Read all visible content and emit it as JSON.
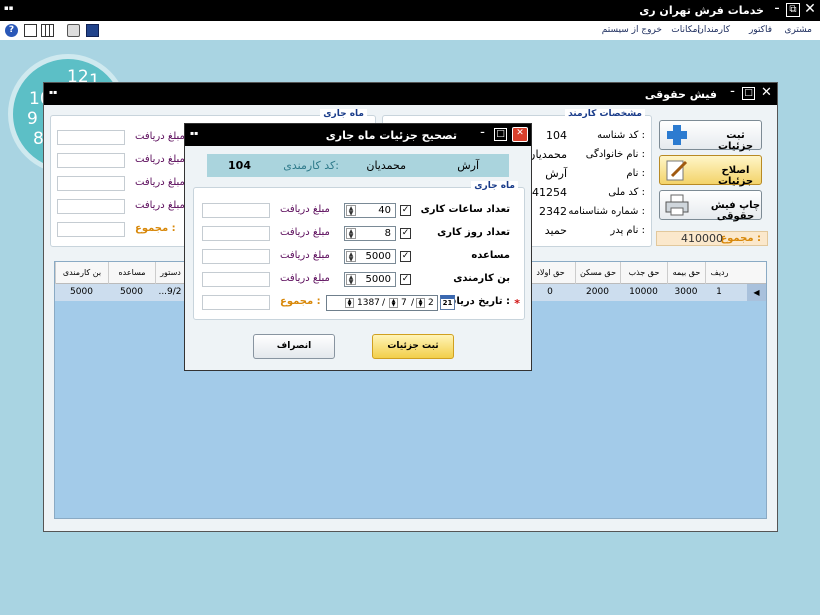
{
  "app": {
    "title": "خدمات فرش تهران ری"
  },
  "menu": [
    "مشتری",
    "فاکتور",
    "کارمندان",
    "امکانات",
    "خروج از سیستم"
  ],
  "clock": {
    "numbers": [
      "12",
      "10",
      "9",
      "8",
      "1"
    ]
  },
  "main_window": {
    "title": "فیش حقوقی",
    "employee_group": {
      "legend": "مشخصات کارمند",
      "fields": [
        {
          "label": "کد شناسه :",
          "value": "104"
        },
        {
          "label": "نام خانوادگی :",
          "value": "محمدیان"
        },
        {
          "label": "نام :",
          "value": "آرش"
        },
        {
          "label": "کد ملی :",
          "value": "441254"
        },
        {
          "label": "شماره شناسنامه :",
          "value": "2342"
        },
        {
          "label": "نام پدر :",
          "value": "حمید"
        }
      ]
    },
    "month_group": {
      "legend": "ماه جاری",
      "rows": [
        "مبلغ دریافت",
        "مبلغ دریافت",
        "مبلغ دریافت",
        "مبلغ دریافت"
      ],
      "total_label": "مجموع :"
    },
    "total": {
      "label": "مجموع :",
      "value": "410000"
    },
    "buttons": {
      "save": "ثبت جزئیات",
      "edit": "اصلاح جزئیات",
      "print": "چاپ فیش حقوقی"
    },
    "grid": {
      "headers": [
        "ردیف",
        "حق بیمه",
        "حق جذب",
        "حق مسکن",
        "حق اولاد",
        "دستور",
        "مساعده",
        "بن کارمندی"
      ],
      "rows": [
        [
          "1",
          "3000",
          "10000",
          "2000",
          "0",
          "...9/2",
          "5000",
          "5000"
        ]
      ]
    }
  },
  "dialog": {
    "title": "تصحیح جزئیات ماه جاری",
    "employee": {
      "first_name": "آرش",
      "last_name": "محمدیان",
      "code_label": "کد کارمندی:",
      "code": "104"
    },
    "legend": "ماه جاری",
    "rows": [
      {
        "label": "تعداد ساعات کاری",
        "value": "40",
        "amount_label": "مبلغ دریافت"
      },
      {
        "label": "تعداد روز کاری",
        "value": "8",
        "amount_label": "مبلغ دریافت"
      },
      {
        "label": "مساعده",
        "value": "5000",
        "amount_label": "مبلغ دریافت"
      },
      {
        "label": "بن کارمندی",
        "value": "5000",
        "amount_label": "مبلغ دریافت"
      }
    ],
    "date": {
      "label": "تاریخ دریافت :",
      "day": "2",
      "month": "7",
      "year": "1387",
      "calendar": "21",
      "sep": "/",
      "star": "*"
    },
    "total_label": "مجموع :",
    "ok_label": "ثبت جزئیات",
    "cancel_label": "انصراف"
  },
  "colors": {
    "desktop": "#a9d4e2",
    "accent": "#1a3c8a",
    "amount_label": "#5a0a5a",
    "total": "#d8880a",
    "grid_bg": "#a3cbe9"
  }
}
